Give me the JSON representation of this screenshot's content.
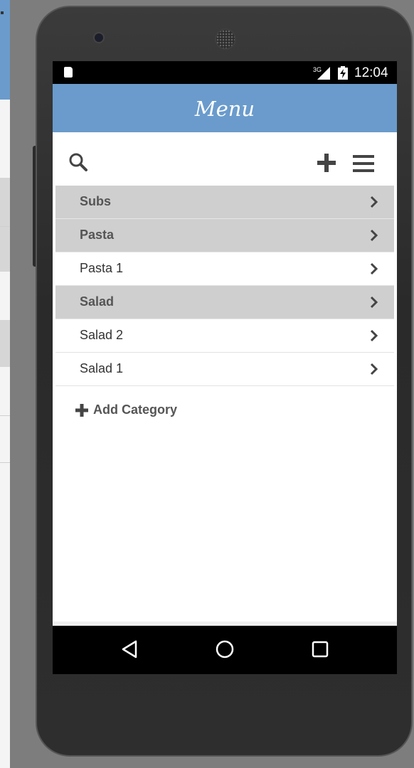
{
  "status_bar": {
    "network": "3G",
    "time": "12:04"
  },
  "app": {
    "title": "Menu",
    "accent_color": "#6a9bcc",
    "category_row_color": "#cfcfcf"
  },
  "toolbar": {
    "icons": [
      "search-icon",
      "plus-icon",
      "hamburger-menu-icon"
    ]
  },
  "menu_items": [
    {
      "label": "Subs",
      "type": "category"
    },
    {
      "label": "Pasta",
      "type": "category"
    },
    {
      "label": "Pasta 1",
      "type": "item"
    },
    {
      "label": "Salad",
      "type": "category"
    },
    {
      "label": "Salad 2",
      "type": "item"
    },
    {
      "label": "Salad 1",
      "type": "item"
    }
  ],
  "add_category": {
    "label": "Add Category"
  },
  "nav_bar": {
    "icons": [
      "back-icon",
      "home-icon",
      "recents-icon"
    ]
  }
}
